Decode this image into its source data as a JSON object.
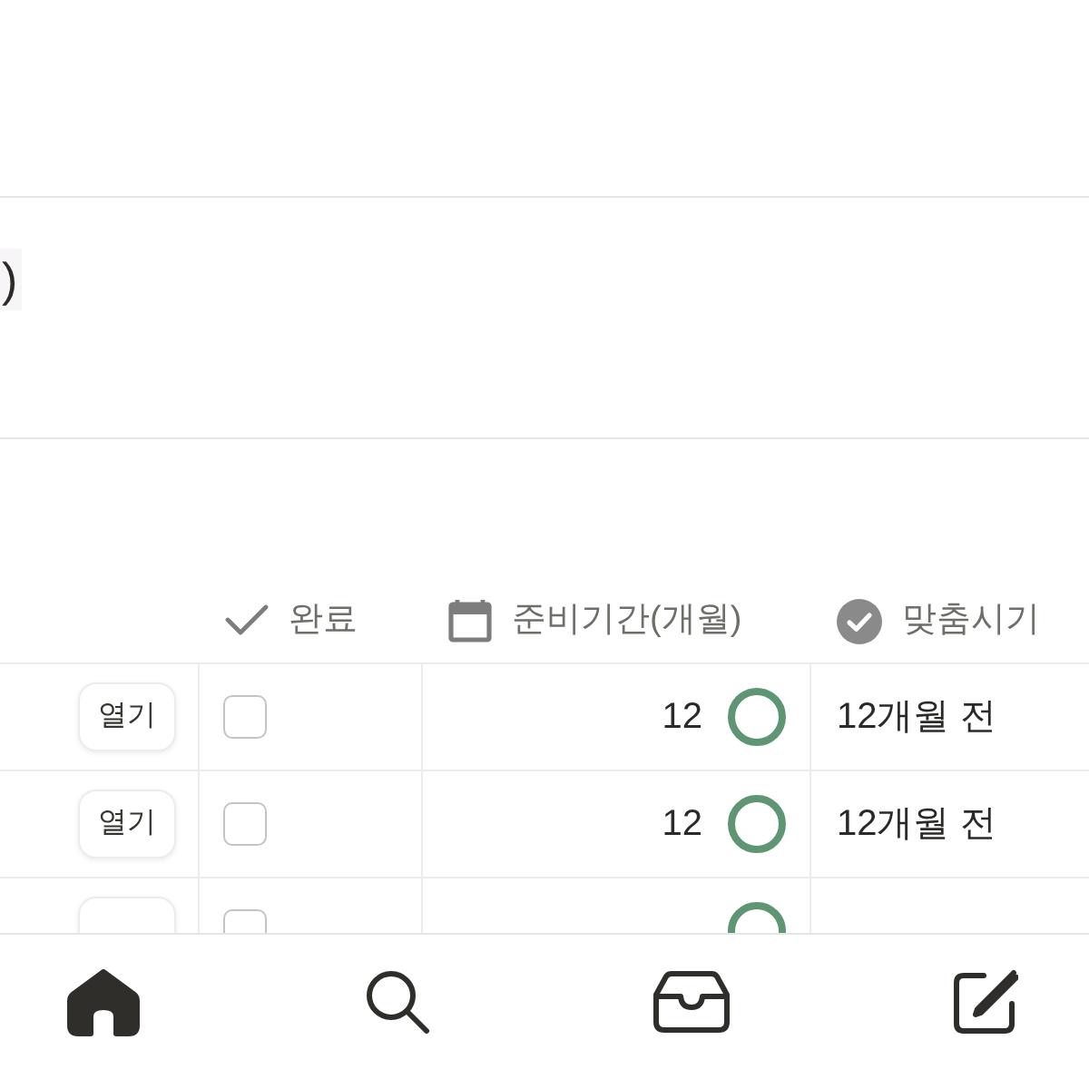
{
  "page_title": {
    "text": ")"
  },
  "table": {
    "columns": [
      {
        "kind": "check",
        "label": "완료"
      },
      {
        "kind": "calendar",
        "label": "준비기간(개월)"
      },
      {
        "kind": "check-circle",
        "label": "맞춤시기"
      }
    ],
    "rows": [
      {
        "button": "열기",
        "checked": false,
        "months": "12",
        "timing": "12개월 전"
      },
      {
        "button": "열기",
        "checked": false,
        "months": "12",
        "timing": "12개월 전"
      },
      {
        "checked": false
      }
    ]
  },
  "bottom_nav": [
    {
      "kind": "home",
      "selected": true
    },
    {
      "kind": "search",
      "selected": false
    },
    {
      "kind": "inbox",
      "selected": false
    },
    {
      "kind": "compose",
      "selected": false
    }
  ]
}
